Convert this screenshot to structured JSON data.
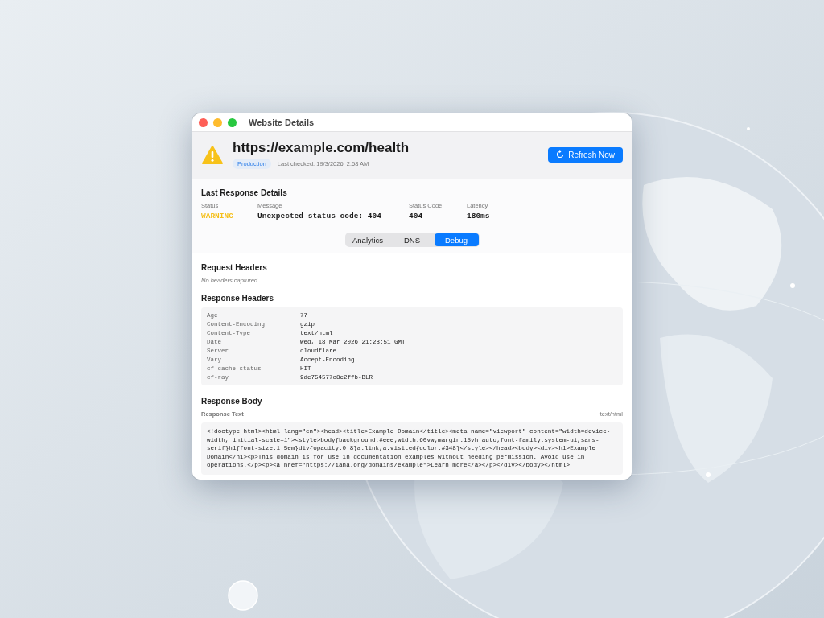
{
  "window": {
    "title": "Website Details"
  },
  "header": {
    "url": "https://example.com/health",
    "environment": "Production",
    "last_checked": "Last checked: 19/3/2026, 2:58 AM",
    "refresh_button": "Refresh Now"
  },
  "last_response": {
    "title": "Last Response Details",
    "fields": [
      {
        "label": "Status",
        "value": "WARNING",
        "kind": "status"
      },
      {
        "label": "Message",
        "value": "Unexpected status code: 404",
        "kind": "plain"
      },
      {
        "label": "Status Code",
        "value": "404",
        "kind": "plain"
      },
      {
        "label": "Latency",
        "value": "180ms",
        "kind": "plain"
      }
    ]
  },
  "tabs": [
    {
      "label": "Analytics",
      "selected": false
    },
    {
      "label": "DNS",
      "selected": false
    },
    {
      "label": "Debug",
      "selected": true
    }
  ],
  "request_headers": {
    "title": "Request Headers",
    "empty_text": "No headers captured"
  },
  "response_headers": {
    "title": "Response Headers",
    "rows": [
      {
        "name": "Age",
        "value": "77"
      },
      {
        "name": "Content-Encoding",
        "value": "gzip"
      },
      {
        "name": "Content-Type",
        "value": "text/html"
      },
      {
        "name": "Date",
        "value": "Wed, 18 Mar 2026 21:28:51 GMT"
      },
      {
        "name": "Server",
        "value": "cloudflare"
      },
      {
        "name": "Vary",
        "value": "Accept-Encoding"
      },
      {
        "name": "cf-cache-status",
        "value": "HIT"
      },
      {
        "name": "cf-ray",
        "value": "9de754577c8e2ffb-BLR"
      }
    ]
  },
  "response_body": {
    "title": "Response Body",
    "label": "Response Text",
    "content_type": "text/html",
    "lines": [
      "<!doctype html><html lang=\"en\"><head><title>Example Domain</title><meta name=\"viewport\" content=\"width=device-",
      "width, initial-scale=1\"><style>body{background:#eee;width:60vw;margin:15vh auto;font-family:system-ui,sans-",
      "serif}h1{font-size:1.5em}div{opacity:0.8}a:link,a:visited{color:#348}</style></head><body><div><h1>Example",
      "Domain</h1><p>This domain is for use in documentation examples without needing permission. Avoid use in",
      "operations.</p><p><a href=\"https://iana.org/domains/example\">Learn more</a></p></div></body></html>"
    ]
  }
}
